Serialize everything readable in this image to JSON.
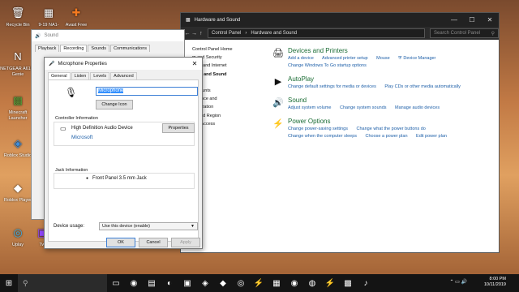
{
  "desktop": {
    "icons": [
      {
        "label": "Recycle Bin",
        "glyph": "🗑",
        "icon": "recycle-bin-icon"
      },
      {
        "label": "9-19 NA1-",
        "glyph": "▦",
        "icon": "image-file-icon"
      },
      {
        "label": "Avast Free",
        "glyph": "✚",
        "icon": "avast-icon"
      },
      {
        "label": "NETGEAR A6100 Genie",
        "glyph": "N",
        "icon": "netgear-icon"
      },
      {
        "label": "Minecraft Launcher",
        "glyph": "▩",
        "icon": "minecraft-icon"
      },
      {
        "label": "Roblox Studio",
        "glyph": "◈",
        "icon": "roblox-studio-icon"
      },
      {
        "label": "Roblox Player",
        "glyph": "◆",
        "icon": "roblox-player-icon"
      },
      {
        "label": "Uplay",
        "glyph": "◎",
        "icon": "uplay-icon"
      },
      {
        "label": "Tw",
        "glyph": "▣",
        "icon": "twitch-icon"
      }
    ]
  },
  "control_panel": {
    "title": "Hardware and Sound",
    "window_controls": [
      "—",
      "☐",
      "✕"
    ],
    "nav": [
      "←",
      "→",
      "↑"
    ],
    "breadcrumb": [
      "Control Panel",
      "›",
      "Hardware and Sound"
    ],
    "search_placeholder": "Search Control Panel",
    "left_nav": [
      "Control Panel Home",
      "m and Security",
      "work and Internet",
      "ware and Sound",
      "rams",
      "Accounts",
      "earance and",
      "onalization",
      "ck and Region",
      "e of Access"
    ],
    "categories": [
      {
        "title": "Devices and Printers",
        "glyph": "🖨",
        "links": [
          "Add a device",
          "Advanced printer setup",
          "Mouse",
          "Device Manager",
          "Change Windows To Go startup options"
        ]
      },
      {
        "title": "AutoPlay",
        "glyph": "▶",
        "links": [
          "Change default settings for media or devices",
          "Play CDs or other media automatically"
        ]
      },
      {
        "title": "Sound",
        "glyph": "🔊",
        "links": [
          "Adjust system volume",
          "Change system sounds",
          "Manage audio devices"
        ]
      },
      {
        "title": "Power Options",
        "glyph": "⚡",
        "links": [
          "Change power-saving settings",
          "Change what the power buttons do",
          "Change when the computer sleeps",
          "Choose a power plan",
          "Edit power plan"
        ]
      }
    ]
  },
  "sound_dialog": {
    "title": "Sound",
    "tabs": [
      "Playback",
      "Recording",
      "Sounds",
      "Communications"
    ]
  },
  "mic_dialog": {
    "title": "Microphone Properties",
    "close": "✕",
    "tabs": [
      "General",
      "Listen",
      "Levels",
      "Advanced"
    ],
    "name_value": "Microphone",
    "change_icon": "Change Icon",
    "controller_label": "Controller Information",
    "controller_name": "High Definition Audio Device",
    "controller_vendor": "Microsoft",
    "properties": "Properties",
    "jack_label": "Jack Information",
    "jack_value": "Front Panel 3.5 mm Jack",
    "usage_label": "Device usage:",
    "usage_value": "Use this device (enable)",
    "ok": "OK",
    "cancel": "Cancel",
    "apply": "Apply"
  },
  "taskbar": {
    "start_glyph": "⊞",
    "search_glyph": "⚲",
    "apps": [
      {
        "glyph": "▭",
        "icon": "task-view-icon"
      },
      {
        "glyph": "◉",
        "icon": "chrome-icon"
      },
      {
        "glyph": "▤",
        "icon": "file-explorer-icon"
      },
      {
        "glyph": "◐",
        "icon": "steam-icon"
      },
      {
        "glyph": "▣",
        "icon": "store-icon"
      },
      {
        "glyph": "◈",
        "icon": "roblox-icon"
      },
      {
        "glyph": "◆",
        "icon": "app-icon"
      },
      {
        "glyph": "◎",
        "icon": "uplay-icon"
      },
      {
        "glyph": "⚡",
        "icon": "app-icon-2"
      },
      {
        "glyph": "▦",
        "icon": "twitch-icon"
      },
      {
        "glyph": "◉",
        "icon": "chrome-icon-2"
      },
      {
        "glyph": "◍",
        "icon": "app-icon-3"
      },
      {
        "glyph": "⚡",
        "icon": "app-icon-4"
      },
      {
        "glyph": "▩",
        "icon": "control-panel-icon"
      },
      {
        "glyph": "♪",
        "icon": "sound-icon"
      }
    ],
    "time": "8:00 PM",
    "date": "10/11/2019",
    "tray_glyph": "⌃ ▭ 🔊"
  }
}
